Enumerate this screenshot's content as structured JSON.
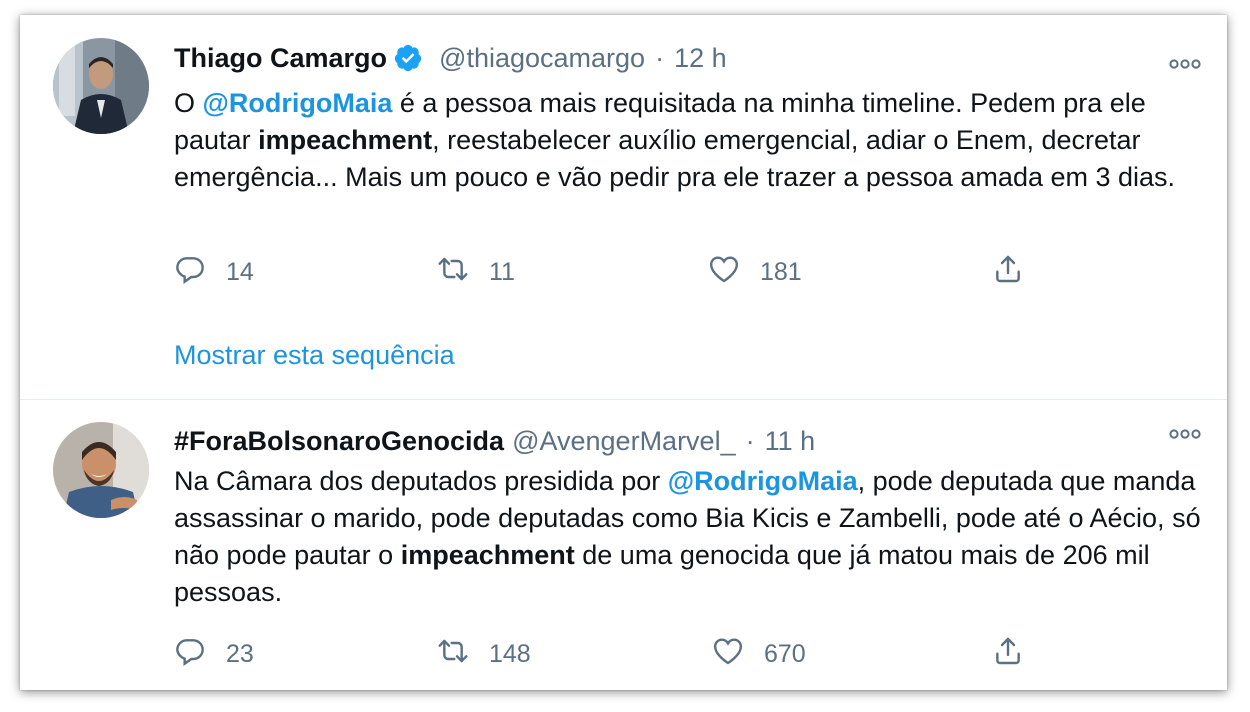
{
  "tweets": [
    {
      "author_name": "Thiago Camargo",
      "verified": true,
      "handle": "@thiagocamargo",
      "separator": "·",
      "time": "12 h",
      "text_parts": [
        {
          "t": "O ",
          "s": ""
        },
        {
          "t": "@RodrigoMaia",
          "s": "mention"
        },
        {
          "t": " é a pessoa mais requisitada na minha timeline. Pedem pra ele pautar ",
          "s": ""
        },
        {
          "t": "impeachment",
          "s": "bold"
        },
        {
          "t": ", reestabelecer auxílio emergencial, adiar o Enem, decretar emergência... Mais um pouco e vão pedir pra ele trazer a pessoa amada em 3 dias.",
          "s": ""
        }
      ],
      "replies": "14",
      "retweets": "11",
      "likes": "181",
      "show_thread": "Mostrar esta sequência"
    },
    {
      "author_name": "#ForaBolsonaroGenocida",
      "verified": false,
      "handle": "@AvengerMarvel_",
      "separator": "·",
      "time": "11 h",
      "text_parts": [
        {
          "t": "Na Câmara dos deputados presidida por ",
          "s": ""
        },
        {
          "t": "@RodrigoMaia",
          "s": "mention"
        },
        {
          "t": ", pode deputada que manda assassinar o marido, pode deputadas como Bia Kicis e Zambelli, pode até o Aécio, só não pode pautar o ",
          "s": ""
        },
        {
          "t": "impeachment",
          "s": "bold"
        },
        {
          "t": " de uma genocida que já matou mais de 206 mil pessoas.",
          "s": ""
        }
      ],
      "replies": "23",
      "retweets": "148",
      "likes": "670"
    }
  ],
  "icons": {
    "more": "more-horizontal-icon",
    "reply": "reply-icon",
    "retweet": "retweet-icon",
    "like": "heart-icon",
    "share": "share-icon",
    "verified": "verified-badge-icon"
  },
  "colors": {
    "link": "#1b95e0",
    "secondary": "#5b7083",
    "verified": "#1da1f2"
  }
}
